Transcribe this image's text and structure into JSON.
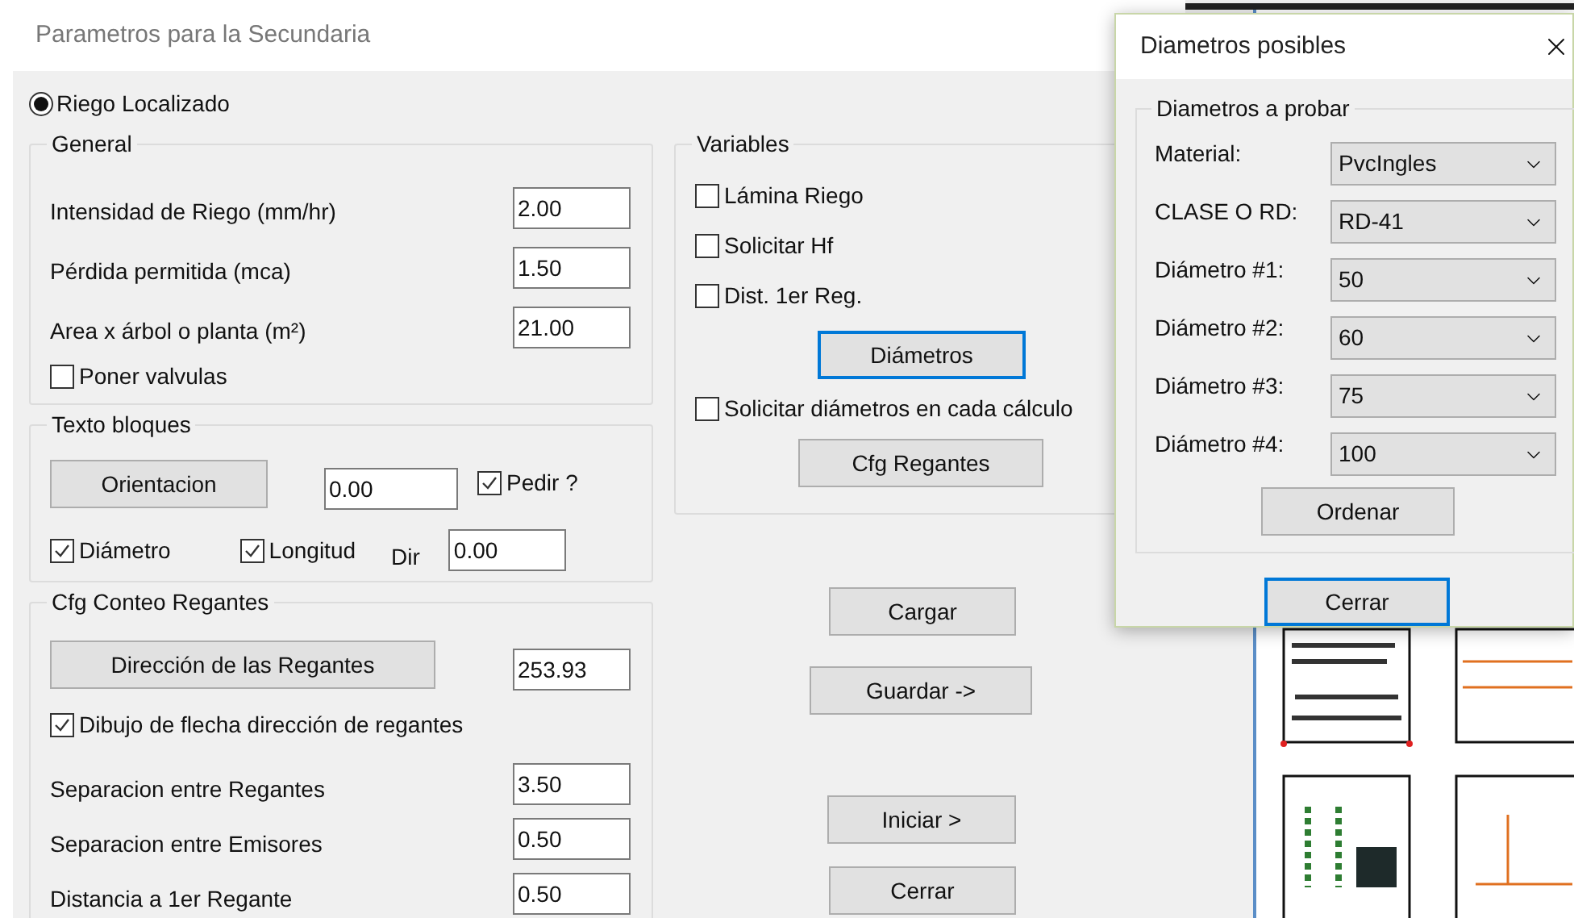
{
  "window": {
    "title": "Parametros para la Secundaria"
  },
  "mode_radio": {
    "label": "Riego Localizado",
    "selected": true
  },
  "general": {
    "title": "General",
    "fields": [
      {
        "label": "Intensidad de Riego (mm/hr)",
        "value": "2.00"
      },
      {
        "label": "Pérdida permitida (mca)",
        "value": "1.50"
      },
      {
        "label": "Area x árbol o planta (m²)",
        "value": "21.00"
      }
    ],
    "checkbox": {
      "label": "Poner valvulas",
      "checked": false
    }
  },
  "texto_bloques": {
    "title": "Texto bloques",
    "orientation_button": {
      "label": "Orientacion",
      "focused": false
    },
    "orientation_value": "0.00",
    "pedir": {
      "label": "Pedir ?",
      "checked": true
    },
    "diametro": {
      "label": "Diámetro",
      "checked": true
    },
    "longitud": {
      "label": "Longitud",
      "checked": true
    },
    "dir_label": "Dir",
    "dir_value": "0.00"
  },
  "cfg_conteo": {
    "title": "Cfg Conteo Regantes",
    "direction_button": {
      "label": "Dirección de las Regantes",
      "focused": false
    },
    "direction_value": "253.93",
    "arrow_checkbox": {
      "label": "Dibujo de flecha dirección de regantes",
      "checked": true
    },
    "fields": [
      {
        "label": "Separacion entre Regantes",
        "value": "3.50"
      },
      {
        "label": "Separacion entre Emisores",
        "value": "0.50"
      },
      {
        "label": "Distancia a 1er Regante",
        "value": "0.50"
      }
    ]
  },
  "variables": {
    "title": "Variables",
    "checkboxes": [
      {
        "label": "Lámina Riego",
        "checked": false
      },
      {
        "label": "Solicitar Hf",
        "checked": false
      },
      {
        "label": "Dist. 1er Reg.",
        "checked": false
      }
    ],
    "diameters_button": {
      "label": "Diámetros",
      "focused": true
    },
    "ask_checkbox": {
      "label": "Solicitar diámetros en cada cálculo",
      "checked": false
    },
    "cfg_button": {
      "label": "Cfg Regantes",
      "focused": false
    }
  },
  "actions": [
    {
      "label": "Cargar",
      "focused": false
    },
    {
      "label": "Guardar ->",
      "focused": false
    },
    {
      "label": "Iniciar >",
      "focused": false
    },
    {
      "label": "Cerrar",
      "focused": false
    }
  ],
  "dialog": {
    "title": "Diametros posibles",
    "group_title": "Diametros a probar",
    "rows": [
      {
        "label": "Material:",
        "value": "PvcIngles"
      },
      {
        "label": "CLASE O RD:",
        "value": "RD-41"
      },
      {
        "label": "Diámetro #1:",
        "value": "50"
      },
      {
        "label": "Diámetro #2:",
        "value": "60"
      },
      {
        "label": "Diámetro #3:",
        "value": "75"
      },
      {
        "label": "Diámetro #4:",
        "value": "100"
      }
    ],
    "sort_button": {
      "label": "Ordenar",
      "focused": false
    },
    "close_button": {
      "label": "Cerrar",
      "focused": true
    }
  }
}
